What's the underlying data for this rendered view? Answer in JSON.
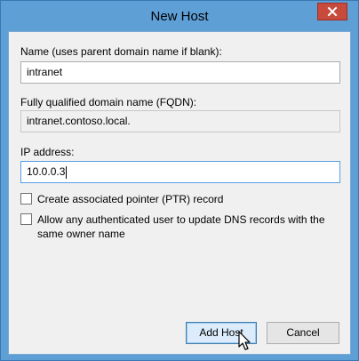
{
  "window": {
    "title": "New Host",
    "close_glyph": "✕",
    "accent_color": "#5e9fd6",
    "close_color": "#c74a3c"
  },
  "form": {
    "name_label": "Name (uses parent domain name if blank):",
    "name_value": "intranet",
    "fqdn_label": "Fully qualified domain name (FQDN):",
    "fqdn_value": "intranet.contoso.local.",
    "ip_label": "IP address:",
    "ip_value": "10.0.0.3",
    "ptr_label": "Create associated pointer (PTR) record",
    "ptr_checked": false,
    "allow_label": "Allow any authenticated user to update DNS records with the same owner name",
    "allow_checked": false
  },
  "buttons": {
    "add_host": "Add Host",
    "cancel": "Cancel"
  },
  "icons": {
    "close": "close-icon",
    "cursor": "mouse-pointer-icon"
  }
}
